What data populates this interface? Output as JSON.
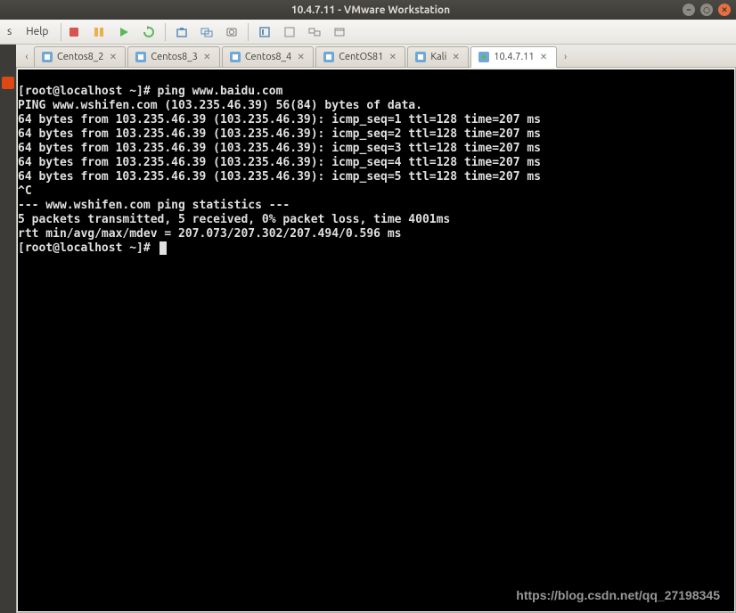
{
  "titlebar": {
    "title": "10.4.7.11 - VMware Workstation",
    "min_icon": "–",
    "max_icon": "○",
    "close_icon": "✕"
  },
  "menubar": {
    "items": [
      "s",
      "Help"
    ]
  },
  "toolbar": {
    "icons": [
      "power-off-icon",
      "pause-icon",
      "play-icon",
      "reset-icon",
      "snapshot-icon",
      "snapshot-manager-icon",
      "screenshot-icon",
      "fullscreen-icon",
      "unity-icon",
      "console-icon",
      "thumbnail-icon"
    ]
  },
  "tabs": [
    {
      "label": "Centos8_2",
      "icon": "vm-linux-icon",
      "active": false
    },
    {
      "label": "Centos8_3",
      "icon": "vm-linux-icon",
      "active": false
    },
    {
      "label": "Centos8_4",
      "icon": "vm-linux-icon",
      "active": false
    },
    {
      "label": "CentOS81",
      "icon": "vm-linux-icon",
      "active": false
    },
    {
      "label": "Kali",
      "icon": "vm-linux-icon",
      "active": false
    },
    {
      "label": "10.4.7.11",
      "icon": "vm-running-icon",
      "active": true
    }
  ],
  "tab_close_glyph": "✕",
  "tab_nav": {
    "prev": "‹",
    "next": "›"
  },
  "terminal": {
    "lines": [
      "[root@localhost ~]# ping www.baidu.com",
      "PING www.wshifen.com (103.235.46.39) 56(84) bytes of data.",
      "64 bytes from 103.235.46.39 (103.235.46.39): icmp_seq=1 ttl=128 time=207 ms",
      "64 bytes from 103.235.46.39 (103.235.46.39): icmp_seq=2 ttl=128 time=207 ms",
      "64 bytes from 103.235.46.39 (103.235.46.39): icmp_seq=3 ttl=128 time=207 ms",
      "64 bytes from 103.235.46.39 (103.235.46.39): icmp_seq=4 ttl=128 time=207 ms",
      "64 bytes from 103.235.46.39 (103.235.46.39): icmp_seq=5 ttl=128 time=207 ms",
      "^C",
      "--- www.wshifen.com ping statistics ---",
      "5 packets transmitted, 5 received, 0% packet loss, time 4001ms",
      "rtt min/avg/max/mdev = 207.073/207.302/207.494/0.596 ms",
      "[root@localhost ~]# "
    ]
  },
  "watermark": "https://blog.csdn.net/qq_27198345"
}
